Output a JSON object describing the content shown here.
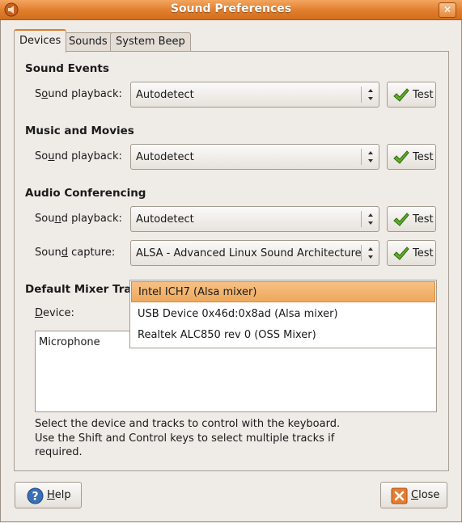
{
  "window": {
    "title": "Sound Preferences",
    "close_symbol": "✕",
    "accent": "#e07d2b"
  },
  "tabs": [
    {
      "label": "Devices"
    },
    {
      "label": "Sounds"
    },
    {
      "label": "System Beep"
    }
  ],
  "sections": {
    "sound_events": {
      "title": "Sound Events",
      "playback_label_pre": "S",
      "playback_label_u": "o",
      "playback_label_post": "und playback:",
      "playback_value": "Autodetect"
    },
    "music_movies": {
      "title": "Music and Movies",
      "playback_label_pre": "So",
      "playback_label_u": "u",
      "playback_label_post": "nd playback:",
      "playback_value": "Autodetect"
    },
    "audio_conferencing": {
      "title": "Audio Conferencing",
      "playback_label_pre": "Sou",
      "playback_label_u": "n",
      "playback_label_post": "d playback:",
      "playback_value": "Autodetect",
      "capture_label_pre": "Soun",
      "capture_label_u": "d",
      "capture_label_post": " capture:",
      "capture_value": "ALSA - Advanced Linux Sound Architecture"
    },
    "mixer": {
      "title": "Default Mixer Trac",
      "device_label_u": "D",
      "device_label_post": "evice:",
      "tracks": [
        "Microphone"
      ],
      "help_lines": [
        "Select the device and tracks to control with the keyboard.",
        "Use the Shift and Control keys to select multiple tracks if",
        "required."
      ]
    }
  },
  "test_label": "Test",
  "device_options": [
    "Intel ICH7 (Alsa mixer)",
    "USB Device 0x46d:0x8ad (Alsa mixer)",
    "Realtek ALC850 rev 0 (OSS Mixer)"
  ],
  "footer": {
    "help_u": "H",
    "help_post": "elp",
    "close_u": "C",
    "close_post": "lose"
  }
}
